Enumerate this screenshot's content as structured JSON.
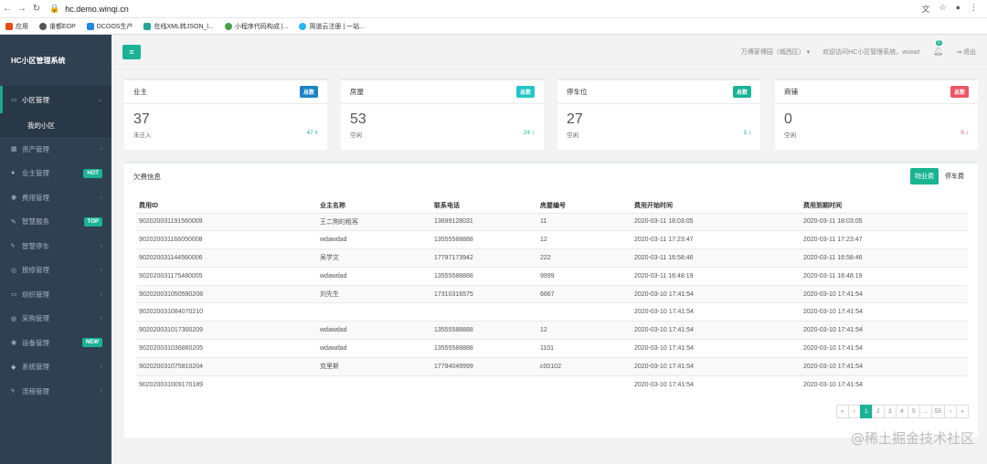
{
  "browser": {
    "url": "hc.demo.winqi.cn",
    "bookmarks": [
      "应用",
      "谁都EOP",
      "DCOOS生产",
      "在线XML转JSON_l...",
      "小程序代码构成 |...",
      "简道云注册 | 一站..."
    ]
  },
  "app": {
    "brand": "HC小区管理系统",
    "community": "万博家博园（城西区）",
    "welcome": "欢迎访问HC小区管理系统，wuxw!",
    "notify_count": "0",
    "logout": "退出"
  },
  "sidebar": {
    "active": {
      "label": "小区管理",
      "sub": "我的小区"
    },
    "items": [
      {
        "label": "资产管理",
        "icon": "grid-icon",
        "badge": ""
      },
      {
        "label": "业主管理",
        "icon": "user-icon",
        "badge": "HOT"
      },
      {
        "label": "费用管理",
        "icon": "money-icon",
        "badge": ""
      },
      {
        "label": "智慧服务",
        "icon": "edit-icon",
        "badge": "TOP"
      },
      {
        "label": "智慧停车",
        "icon": "bolt-icon",
        "badge": ""
      },
      {
        "label": "报修管理",
        "icon": "wrench-icon",
        "badge": ""
      },
      {
        "label": "组织管理",
        "icon": "monitor-icon",
        "badge": ""
      },
      {
        "label": "采购管理",
        "icon": "cart-icon",
        "badge": ""
      },
      {
        "label": "设备管理",
        "icon": "device-icon",
        "badge": "NEW"
      },
      {
        "label": "系统管理",
        "icon": "diamond-icon",
        "badge": ""
      },
      {
        "label": "流程管理",
        "icon": "flow-icon",
        "badge": ""
      }
    ]
  },
  "cards": [
    {
      "title": "业主",
      "tag": "总数",
      "tag_color": "#1c84c6",
      "value": "37",
      "sub": "未迁入",
      "stat": "47",
      "stat_color": "#1ab394",
      "stat_icon": "ϟ"
    },
    {
      "title": "房屋",
      "tag": "总数",
      "tag_color": "#23c6c8",
      "value": "53",
      "sub": "空闲",
      "stat": "24",
      "stat_color": "#1ab394",
      "stat_icon": "↕"
    },
    {
      "title": "停车位",
      "tag": "总数",
      "tag_color": "#1ab394",
      "value": "27",
      "sub": "空闲",
      "stat": "1",
      "stat_color": "#1ab394",
      "stat_icon": "↕"
    },
    {
      "title": "商铺",
      "tag": "总数",
      "tag_color": "#ed5565",
      "value": "0",
      "sub": "空闲",
      "stat": "0",
      "stat_color": "#ed5565",
      "stat_icon": "↕"
    }
  ],
  "arrears": {
    "title": "欠费信息",
    "tabs": [
      "物业费",
      "停车费"
    ],
    "columns": [
      "费用ID",
      "业主名称",
      "联系电话",
      "房屋编号",
      "费用开始时间",
      "费用到期时间"
    ],
    "rows": [
      [
        "902020031191560009",
        "王二狗的租客",
        "13699128031",
        "11",
        "2020-03-11 18:03:05",
        "2020-03-11 18:03:05"
      ],
      [
        "902020031166050008",
        "wdawdad",
        "13555588888",
        "12",
        "2020-03-11 17:23:47",
        "2020-03-11 17:23:47"
      ],
      [
        "902020031144560006",
        "吴学文",
        "17797173942",
        "222",
        "2020-03-11 16:58:46",
        "2020-03-11 16:58:46"
      ],
      [
        "902020031175480005",
        "wdawdad",
        "13555588888",
        "9999",
        "2020-03-11 16:48:19",
        "2020-03-11 16:48:19"
      ],
      [
        "902020031050590208",
        "刘先生",
        "17310316575",
        "6667",
        "2020-03-10 17:41:54",
        "2020-03-10 17:41:54"
      ],
      [
        "902020031084070210",
        "",
        "",
        "",
        "2020-03-10 17:41:54",
        "2020-03-10 17:41:54"
      ],
      [
        "902020031017300209",
        "wdawdad",
        "13555588888",
        "12",
        "2020-03-10 17:41:54",
        "2020-03-10 17:41:54"
      ],
      [
        "902020031036860205",
        "wdawdad",
        "13555588888",
        "1101",
        "2020-03-10 17:41:54",
        "2020-03-10 17:41:54"
      ],
      [
        "902020031075810204",
        "克里斯",
        "17794049999",
        "c00102",
        "2020-03-10 17:41:54",
        "2020-03-10 17:41:54"
      ],
      [
        "902020031009170189",
        "",
        "",
        "",
        "2020-03-10 17:41:54",
        "2020-03-10 17:41:54"
      ]
    ],
    "pager": [
      "«",
      "‹",
      "1",
      "2",
      "3",
      "4",
      "5",
      "...",
      "55",
      "›",
      "»"
    ],
    "current_page": "1"
  },
  "watermark": "@稀土掘金技术社区"
}
